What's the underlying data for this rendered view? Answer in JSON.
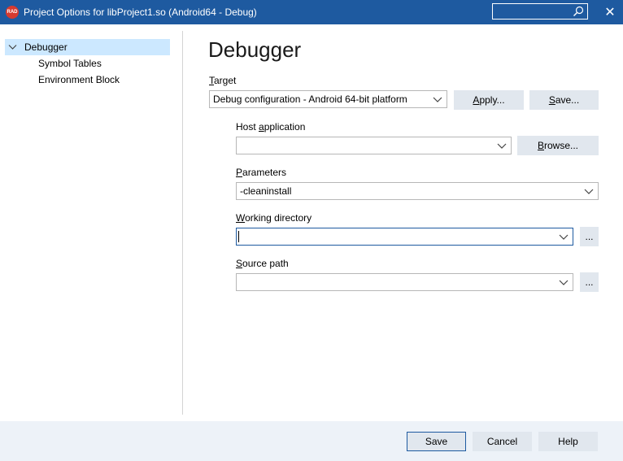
{
  "titlebar": {
    "logo_text": "RAD",
    "title": "Project Options for libProject1.so  (Android64 - Debug)",
    "close_glyph": "✕",
    "icons": [
      "rad-logo-icon",
      "search-icon",
      "close-icon"
    ]
  },
  "tree": {
    "root": "Debugger",
    "children": [
      "Symbol Tables",
      "Environment Block"
    ]
  },
  "main": {
    "title": "Debugger",
    "target": {
      "label_first": "T",
      "label_rest": "arget",
      "value": "Debug configuration - Android 64-bit platform"
    },
    "apply": {
      "first": "A",
      "rest": "pply..."
    },
    "save_target": {
      "first": "S",
      "rest": "ave..."
    },
    "host_application": {
      "label_pre": "Host ",
      "label_u": "a",
      "label_post": "pplication",
      "value": ""
    },
    "browse": {
      "first": "B",
      "rest": "rowse..."
    },
    "parameters": {
      "label_first": "P",
      "label_rest": "arameters",
      "value": "-cleaninstall"
    },
    "working_directory": {
      "label_first": "W",
      "label_rest": "orking directory",
      "value": ""
    },
    "working_browse": "...",
    "source_path": {
      "label_first": "S",
      "label_rest": "ource path",
      "value": ""
    },
    "source_browse": "..."
  },
  "footer": {
    "save": "Save",
    "cancel": "Cancel",
    "help": "Help"
  },
  "colors": {
    "titlebar": "#1e5aa0",
    "selection": "#cce8ff",
    "button": "#e1e7ee",
    "footer": "#edf2f8",
    "focus_border": "#1e5aa0"
  }
}
